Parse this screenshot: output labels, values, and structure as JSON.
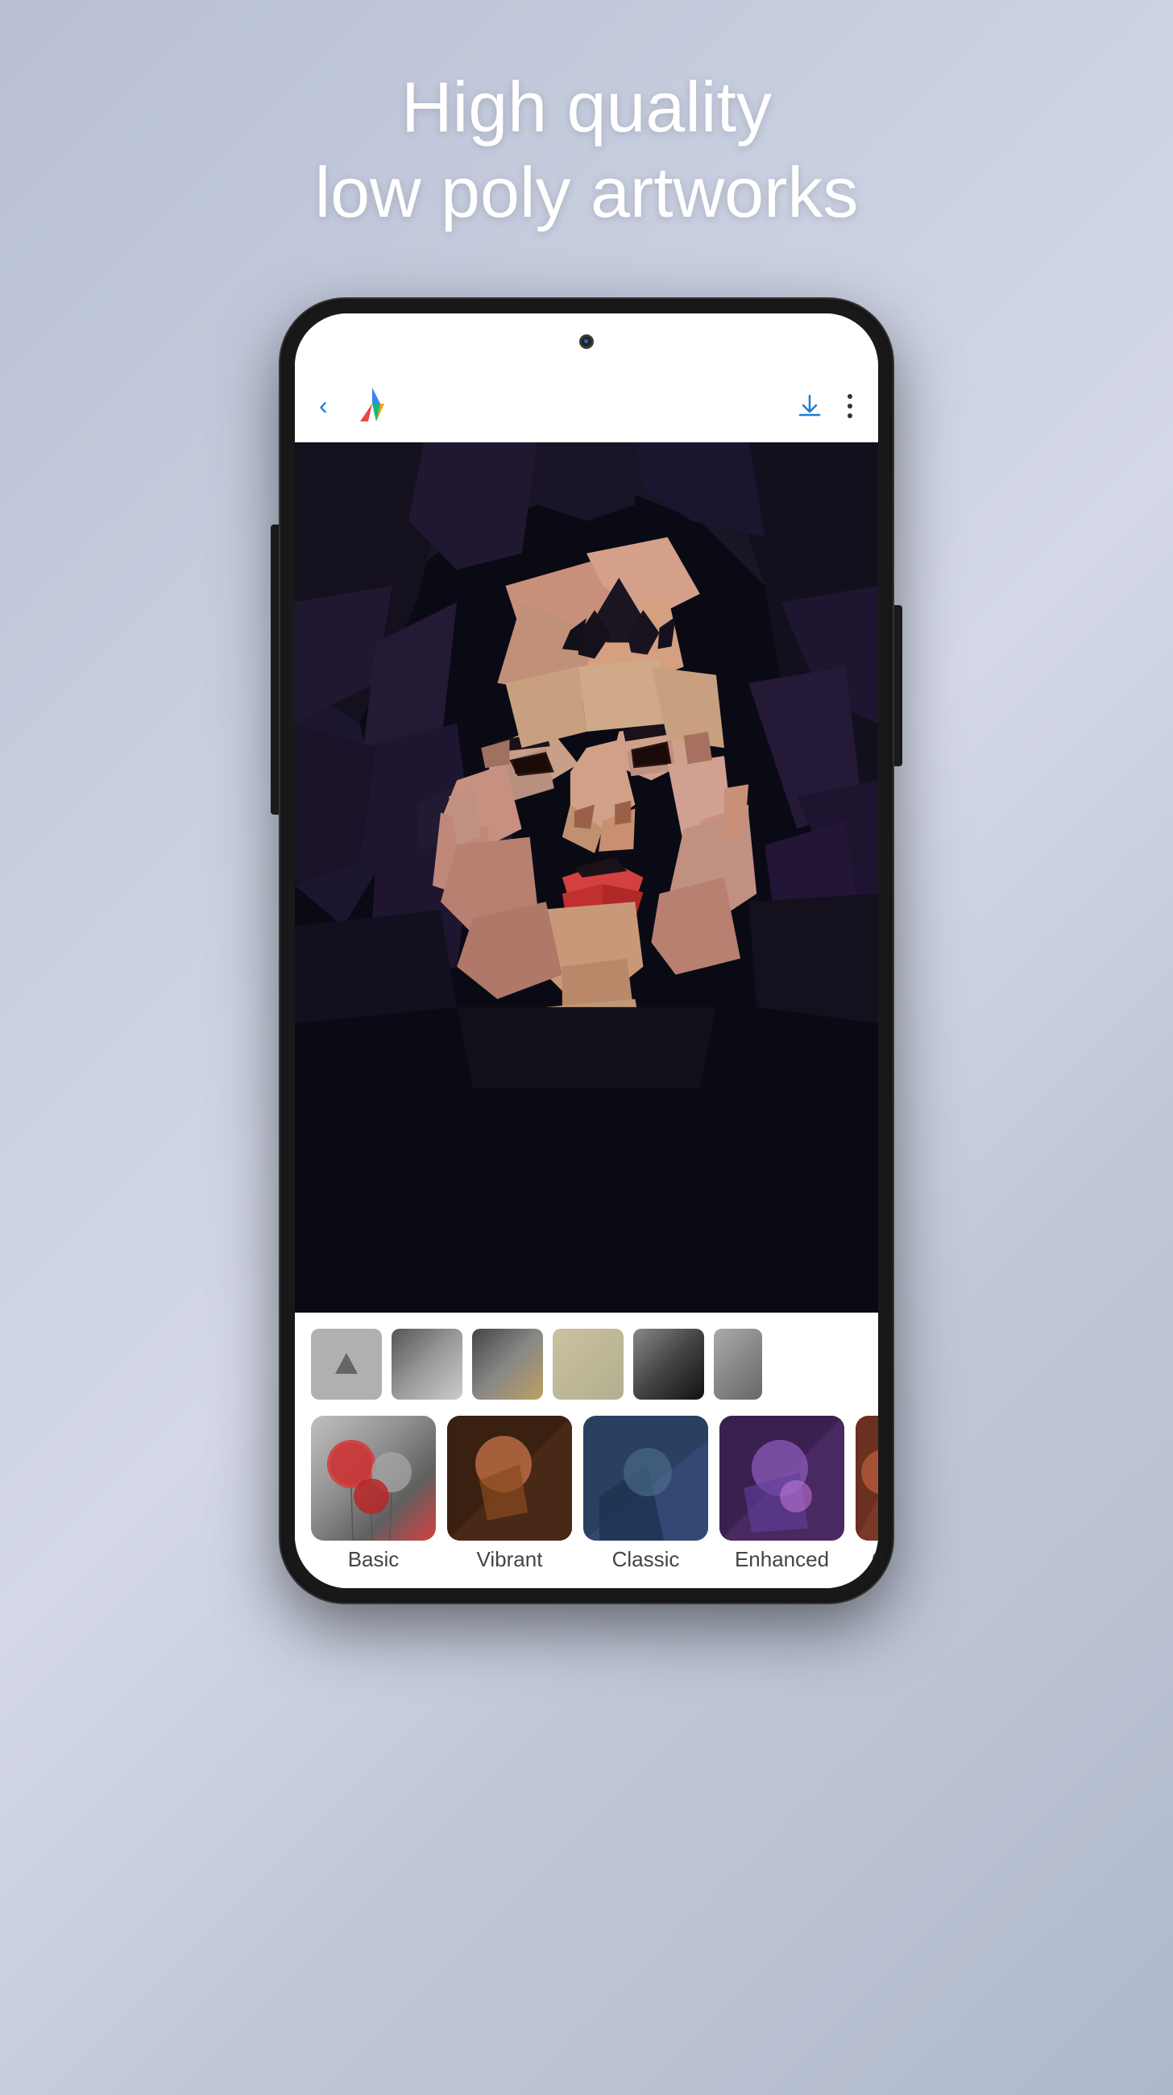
{
  "headline": {
    "line1": "High quality",
    "line2": "low poly artworks"
  },
  "toolbar": {
    "back_label": "‹",
    "download_label": "⬇",
    "more_label": "⋮"
  },
  "filters": {
    "items": [
      {
        "id": "basic",
        "label": "Basic"
      },
      {
        "id": "vibrant",
        "label": "Vibrant"
      },
      {
        "id": "classic",
        "label": "Classic"
      },
      {
        "id": "enhanced",
        "label": "Enhanced"
      },
      {
        "id": "cry",
        "label": "Cry"
      }
    ]
  },
  "logo": {
    "alt": "App logo triangle"
  }
}
